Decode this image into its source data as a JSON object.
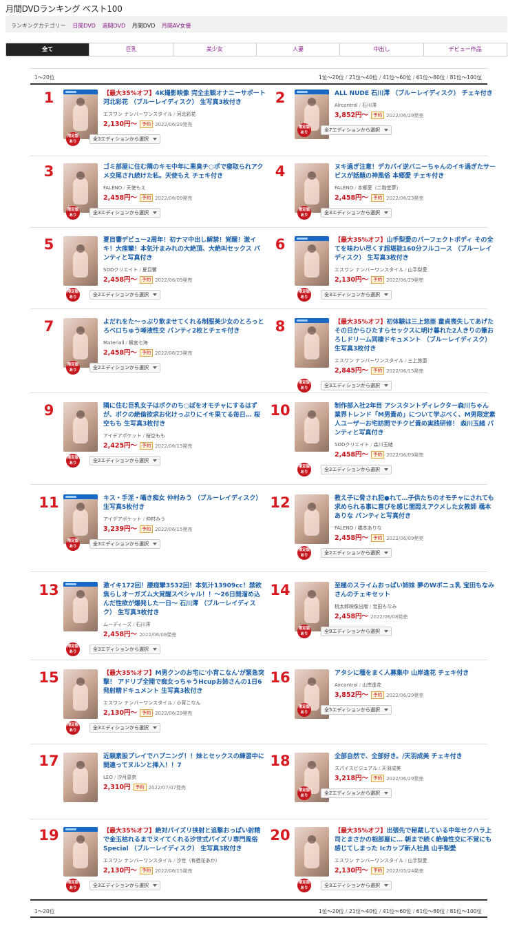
{
  "page_title": "月間DVDランキング ベスト100",
  "category": {
    "label": "ランキングカテゴリー",
    "links": [
      "日間DVD",
      "週間DVD"
    ],
    "current": "月間DVD",
    "extra": "月間AV女優"
  },
  "tabs": [
    "全て",
    "巨乳",
    "美少女",
    "人妻",
    "中出し",
    "デビュー作品"
  ],
  "pager": {
    "range": "1～20位",
    "pages": [
      "1位～20位",
      "21位～40位",
      "41位～60位",
      "61位～80位",
      "81位～100位"
    ]
  },
  "labels": {
    "yoyaku": "予約",
    "limited_1": "限定版",
    "limited_2": "あり"
  },
  "items": [
    {
      "rank": "1",
      "promo": "【最大35%オフ】",
      "title": "4K撮影映像 完全主観オナニーサポート 河北彩花 （ブルーレイディスク） 生写真3枚付き",
      "maker": "エスワン ナンバーワンスタイル",
      "actress": "河北彩花",
      "price": "2,130円～",
      "yoyaku": true,
      "date": "2022/06/29発売",
      "limited": true,
      "editions": "全3エディションから選択",
      "bluray": true
    },
    {
      "rank": "2",
      "promo": "",
      "title": "ALL NUDE 石川澪 （ブルーレイディスク） チェキ付き",
      "maker": "Aircontrol",
      "actress": "石川澪",
      "price": "3,852円～",
      "yoyaku": true,
      "date": "2022/06/29発売",
      "limited": true,
      "editions": "全7エディションから選択",
      "bluray": true
    },
    {
      "rank": "3",
      "promo": "",
      "title": "ゴミ部屋に住む隣のキモ中年に悪臭チ○ポで寝取られアクメ交尾され続けた私。天使もえ チェキ付き",
      "maker": "FALENO",
      "actress": "天使もえ",
      "price": "2,458円～",
      "yoyaku": true,
      "date": "2022/06/09発売",
      "limited": true,
      "editions": "全3エディションから選択",
      "bluray": false
    },
    {
      "rank": "4",
      "promo": "",
      "title": "ヌキ過ぎ注意！デカパイ逆バニーちゃんのイキ過ぎたサービスが話題の神風俗 本郷愛 チェキ付き",
      "maker": "FALENO",
      "actress": "本郷愛（二階堂夢）",
      "price": "2,458円～",
      "yoyaku": true,
      "date": "2022/06/23発売",
      "limited": true,
      "editions": "全3エディションから選択",
      "bluray": false
    },
    {
      "rank": "5",
      "promo": "",
      "title": "夏目響デビュー2周年！初ナマ中出し解禁！覚醒！激イキ！大痙攣！本気汁まみれの大絶頂、大絶叫セックス パンティと写真付き",
      "maker": "SODクリエイト",
      "actress": "夏目響",
      "price": "2,458円～",
      "yoyaku": true,
      "date": "2022/06/09発売",
      "limited": true,
      "editions": "全2エディションから選択",
      "bluray": false
    },
    {
      "rank": "6",
      "promo": "【最大35%オフ】",
      "title": "山手梨愛のパーフェクトボディ その全てを味わい尽くす超堪能160分フルコース （ブルーレイディスク） 生写真3枚付き",
      "maker": "エスワン ナンバーワンスタイル",
      "actress": "山手梨愛",
      "price": "2,130円～",
      "yoyaku": true,
      "date": "2022/06/29発売",
      "limited": true,
      "editions": "全3エディションから選択",
      "bluray": true
    },
    {
      "rank": "7",
      "promo": "",
      "title": "よだれをた～っぷり飲ませてくれる制服美少女のとろっとろベロちゅう唾液性交 パンティ2枚とチェキ付き",
      "maker": "Materiall",
      "actress": "横宮七海",
      "price": "2,458円～",
      "yoyaku": true,
      "date": "2022/06/23発売",
      "limited": true,
      "editions": "全2エディションから選択",
      "bluray": false
    },
    {
      "rank": "8",
      "promo": "【最大35%オフ】",
      "title": "初体験は三上悠亜 童貞喪失してあげたその日からひたすらセックスに明け暮れた2人きりの筆おろしドリーム同棲ドキュメント （ブルーレイディスク） 生写真3枚付き",
      "maker": "エスワン ナンバーワンスタイル",
      "actress": "三上悠亜",
      "price": "2,845円～",
      "yoyaku": true,
      "date": "2022/06/15発売",
      "limited": true,
      "editions": "全3エディションから選択",
      "bluray": true
    },
    {
      "rank": "9",
      "promo": "",
      "title": "隣に住む巨乳女子はボクのち○ぽをオモチャにするはずが、ボクの絶倫欲求お化けっぷりにイキ果てる毎日… 桜空もも 生写真3枚付き",
      "maker": "アイデアポケット",
      "actress": "桜空もも",
      "price": "2,425円～",
      "yoyaku": true,
      "date": "2022/06/15発売",
      "limited": true,
      "editions": "全2エディションから選択",
      "bluray": false
    },
    {
      "rank": "10",
      "promo": "",
      "title": "制作部入社2年目 アシスタントディレクター森川ちゃん 業界トレンド「M男責め」について学ぶべく、M男限定素人ユーザーお宅訪問でチクビ責め実践研修！ 森川玉緒 パンティと写真付き",
      "maker": "SODクリエイト",
      "actress": "森川玉緒",
      "price": "2,458円～",
      "yoyaku": true,
      "date": "2022/06/09発売",
      "limited": true,
      "editions": "全2エディションから選択",
      "bluray": false
    },
    {
      "rank": "11",
      "promo": "",
      "title": "キス・手淫・囁き痴女 仲村みう （ブルーレイディスク） 生写真5枚付き",
      "maker": "アイデアポケット",
      "actress": "仲村みう",
      "price": "3,239円～",
      "yoyaku": true,
      "date": "2022/06/15発売",
      "limited": true,
      "editions": "全3エディションから選択",
      "bluray": true
    },
    {
      "rank": "12",
      "promo": "",
      "title": "教え子に脅され犯●れて…子供たちのオモチャにされても求められる事に喜びを感じ閨悶えアクメした女教師 橋本ありな パンティと写真付き",
      "maker": "FALENO",
      "actress": "橋本ありな",
      "price": "2,458円～",
      "yoyaku": true,
      "date": "2022/06/09発売",
      "limited": true,
      "editions": "全2エディションから選択",
      "bluray": false
    },
    {
      "rank": "13",
      "promo": "",
      "title": "激イキ172回！腰痙攣3532回！本気汁13909cc！禁欲焦らしオーガズム大覚醒スペシャル！！～26日間溜め込んだ性欲が爆発した一日～ 石川澪 （ブルーレイディスク） 生写真3枚付き",
      "maker": "ムーディーズ",
      "actress": "石川澪",
      "price": "2,458円～",
      "yoyaku": false,
      "date": "2022/06/08発売",
      "limited": true,
      "editions": "全3エディションから選択",
      "bluray": true
    },
    {
      "rank": "14",
      "promo": "",
      "title": "至極のスライムおっぱい姉妹 夢のWボニュ乳 宝田もなみさんのチェキセット",
      "maker": "桃太郎映像出版",
      "actress": "宝田もなみ",
      "price": "2,458円～",
      "yoyaku": false,
      "date": "2022/06/08発売",
      "limited": true,
      "editions": "全9エディションから選択",
      "bluray": false
    },
    {
      "rank": "15",
      "promo": "【最大35%オフ】",
      "title": "M男クンのお宅に'小宵こなん'が緊急突撃！ アドリブ全開で痴女っちゃうHcupお姉さんの1日6発射精ドキュメント 生写真3枚付き",
      "maker": "エスワン ナンバーワンスタイル",
      "actress": "小宵こなん",
      "price": "2,130円～",
      "yoyaku": true,
      "date": "2022/06/29発売",
      "limited": true,
      "editions": "全3エディションから選択",
      "bluray": false
    },
    {
      "rank": "16",
      "promo": "",
      "title": "アタシに種をまく人募集中 山岸逢花 チェキ付き",
      "maker": "Aircontrol",
      "actress": "山岸逢花",
      "price": "3,852円～",
      "yoyaku": true,
      "date": "2022/06/29発売",
      "limited": true,
      "editions": "全5エディションから選択",
      "bluray": false
    },
    {
      "rank": "17",
      "promo": "",
      "title": "近親素股プレイでハプニング！！妹とセックスの練習中に間違ってヌルンと挿入！！7",
      "maker": "LEO",
      "actress": "汐月恵奈",
      "price": "2,310円",
      "yoyaku": true,
      "date": "2022/07/07発売",
      "limited": false,
      "editions": "",
      "bluray": false
    },
    {
      "rank": "18",
      "promo": "",
      "title": "全部自然で、全部好き。/天羽成美 チェキ付き",
      "maker": "スパイスビジュアル",
      "actress": "天羽成美",
      "price": "3,218円～",
      "yoyaku": true,
      "date": "2022/06/29発売",
      "limited": true,
      "editions": "全2エディションから選択",
      "bluray": false
    },
    {
      "rank": "19",
      "promo": "【最大35%オフ】",
      "title": "絶対パイズリ挟射と追撃おっぱい射精で金玉枯れるまでヌイてくれる汐世式パイズリ専門風俗Special （ブルーレイディスク） 生写真3枚付き",
      "maker": "エスワン ナンバーワンスタイル",
      "actress": "汐世（有栖花あか）",
      "price": "2,130円～",
      "yoyaku": true,
      "date": "2022/06/15発売",
      "limited": true,
      "editions": "全3エディションから選択",
      "bluray": true
    },
    {
      "rank": "20",
      "promo": "【最大35%オフ】",
      "title": "出張先で秘蔵している中年セクハラ上司とまさかの相部屋に… 朝まで続く絶倫性交に不覚にも感じてしまった Icカップ新人社員 山手梨愛",
      "maker": "エスワン ナンバーワンスタイル",
      "actress": "山手梨愛",
      "price": "2,130円～",
      "yoyaku": true,
      "date": "2022/05/24発売",
      "limited": true,
      "editions": "全3エディションから選択",
      "bluray": false
    }
  ]
}
